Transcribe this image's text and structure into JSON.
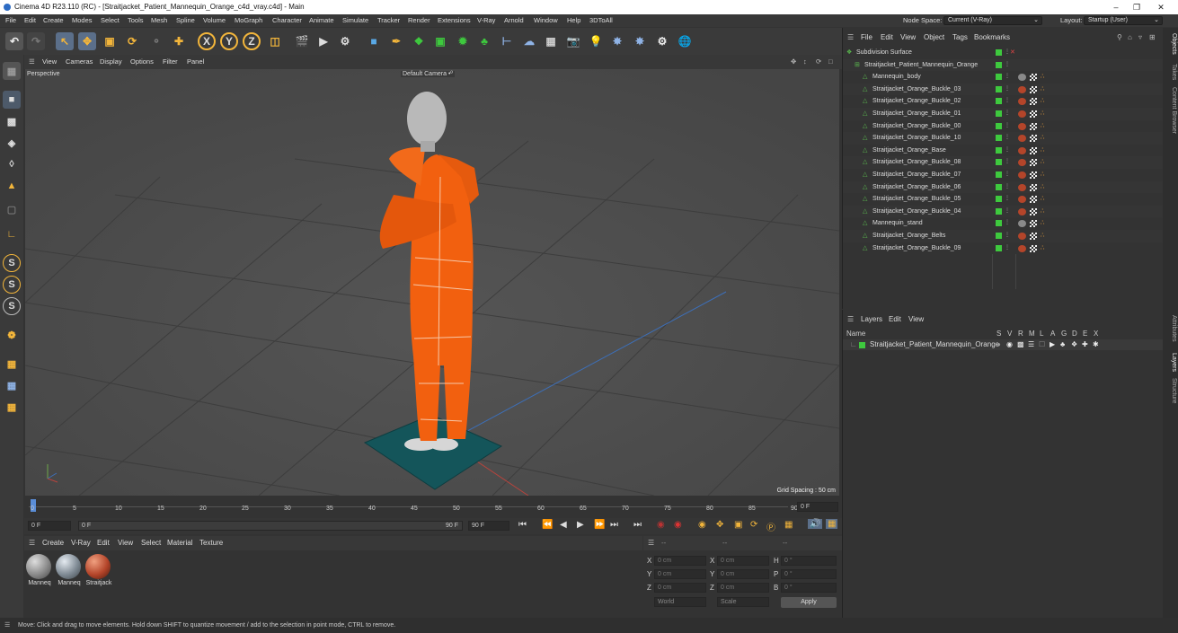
{
  "window": {
    "title": "Cinema 4D R23.110 (RC) - [Straitjacket_Patient_Mannequin_Orange_c4d_vray.c4d] - Main"
  },
  "menu": [
    "File",
    "Edit",
    "Create",
    "Modes",
    "Select",
    "Tools",
    "Mesh",
    "Spline",
    "Volume",
    "MoGraph",
    "Character",
    "Animate",
    "Simulate",
    "Tracker",
    "Render",
    "Extensions",
    "V-Ray",
    "Arnold",
    "Window",
    "Help",
    "3DToAll"
  ],
  "node_space": {
    "label": "Node Space:",
    "value": "Current (V-Ray)"
  },
  "layout": {
    "label": "Layout:",
    "value": "Startup (User)"
  },
  "viewport": {
    "menu": [
      "View",
      "Cameras",
      "Display",
      "Options",
      "Filter",
      "Panel"
    ],
    "view_name": "Perspective",
    "camera": "Default Camera",
    "grid_spacing": "Grid Spacing : 50 cm"
  },
  "timeline": {
    "ticks": [
      "0",
      "5",
      "10",
      "15",
      "20",
      "25",
      "30",
      "35",
      "40",
      "45",
      "50",
      "55",
      "60",
      "65",
      "70",
      "75",
      "80",
      "85",
      "90"
    ],
    "current_frame": "0 F",
    "start": "0 F",
    "range_start": "0 F",
    "range_end": "90 F",
    "end": "90 F"
  },
  "material_manager": {
    "menu": [
      "Create",
      "V-Ray",
      "Edit",
      "View",
      "Select",
      "Material",
      "Texture"
    ],
    "materials": [
      {
        "name": "Manneq",
        "color": "#8a8a8a"
      },
      {
        "name": "Manneq",
        "color": "#7f8a94"
      },
      {
        "name": "Straitjack",
        "color": "#b4452a"
      }
    ]
  },
  "attributes": {
    "header": [
      "--",
      "--",
      "--"
    ],
    "rows": [
      {
        "a": "X",
        "av": "0 cm",
        "b": "X",
        "bv": "0 cm",
        "c": "H",
        "cv": "0 °"
      },
      {
        "a": "Y",
        "av": "0 cm",
        "b": "Y",
        "bv": "0 cm",
        "c": "P",
        "cv": "0 °"
      },
      {
        "a": "Z",
        "av": "0 cm",
        "b": "Z",
        "bv": "0 cm",
        "c": "B",
        "cv": "0 °"
      }
    ],
    "coord_mode": "World",
    "scale_mode": "Scale",
    "apply": "Apply"
  },
  "status": "Move: Click and drag to move elements. Hold down SHIFT to quantize movement / add to the selection in point mode, CTRL to remove.",
  "objects": {
    "menu": [
      "File",
      "Edit",
      "View",
      "Object",
      "Tags",
      "Bookmarks"
    ],
    "items": [
      {
        "name": "Subdivision Surface",
        "level": 0
      },
      {
        "name": "Straitjacket_Patient_Mannequin_Orange",
        "level": 1
      },
      {
        "name": "Mannequin_body",
        "level": 2
      },
      {
        "name": "Straitjacket_Orange_Buckle_03",
        "level": 2
      },
      {
        "name": "Straitjacket_Orange_Buckle_02",
        "level": 2
      },
      {
        "name": "Straitjacket_Orange_Buckle_01",
        "level": 2
      },
      {
        "name": "Straitjacket_Orange_Buckle_00",
        "level": 2
      },
      {
        "name": "Straitjacket_Orange_Buckle_10",
        "level": 2
      },
      {
        "name": "Straitjacket_Orange_Base",
        "level": 2
      },
      {
        "name": "Straitjacket_Orange_Buckle_08",
        "level": 2
      },
      {
        "name": "Straitjacket_Orange_Buckle_07",
        "level": 2
      },
      {
        "name": "Straitjacket_Orange_Buckle_06",
        "level": 2
      },
      {
        "name": "Straitjacket_Orange_Buckle_05",
        "level": 2
      },
      {
        "name": "Straitjacket_Orange_Buckle_04",
        "level": 2
      },
      {
        "name": "Mannequin_stand",
        "level": 2
      },
      {
        "name": "Straitjacket_Orange_Belts",
        "level": 2
      },
      {
        "name": "Straitjacket_Orange_Buckle_09",
        "level": 2
      }
    ]
  },
  "layers": {
    "menu": [
      "Layers",
      "Edit",
      "View"
    ],
    "name_header": "Name",
    "col_headers": [
      "S",
      "V",
      "R",
      "M",
      "L",
      "A",
      "G",
      "D",
      "E",
      "X"
    ],
    "items": [
      {
        "name": "Straitjacket_Patient_Mannequin_Orange"
      }
    ]
  },
  "right_tabs": [
    "Objects",
    "Takes",
    "Content Browser",
    "Attributes",
    "Layers",
    "Structure"
  ]
}
